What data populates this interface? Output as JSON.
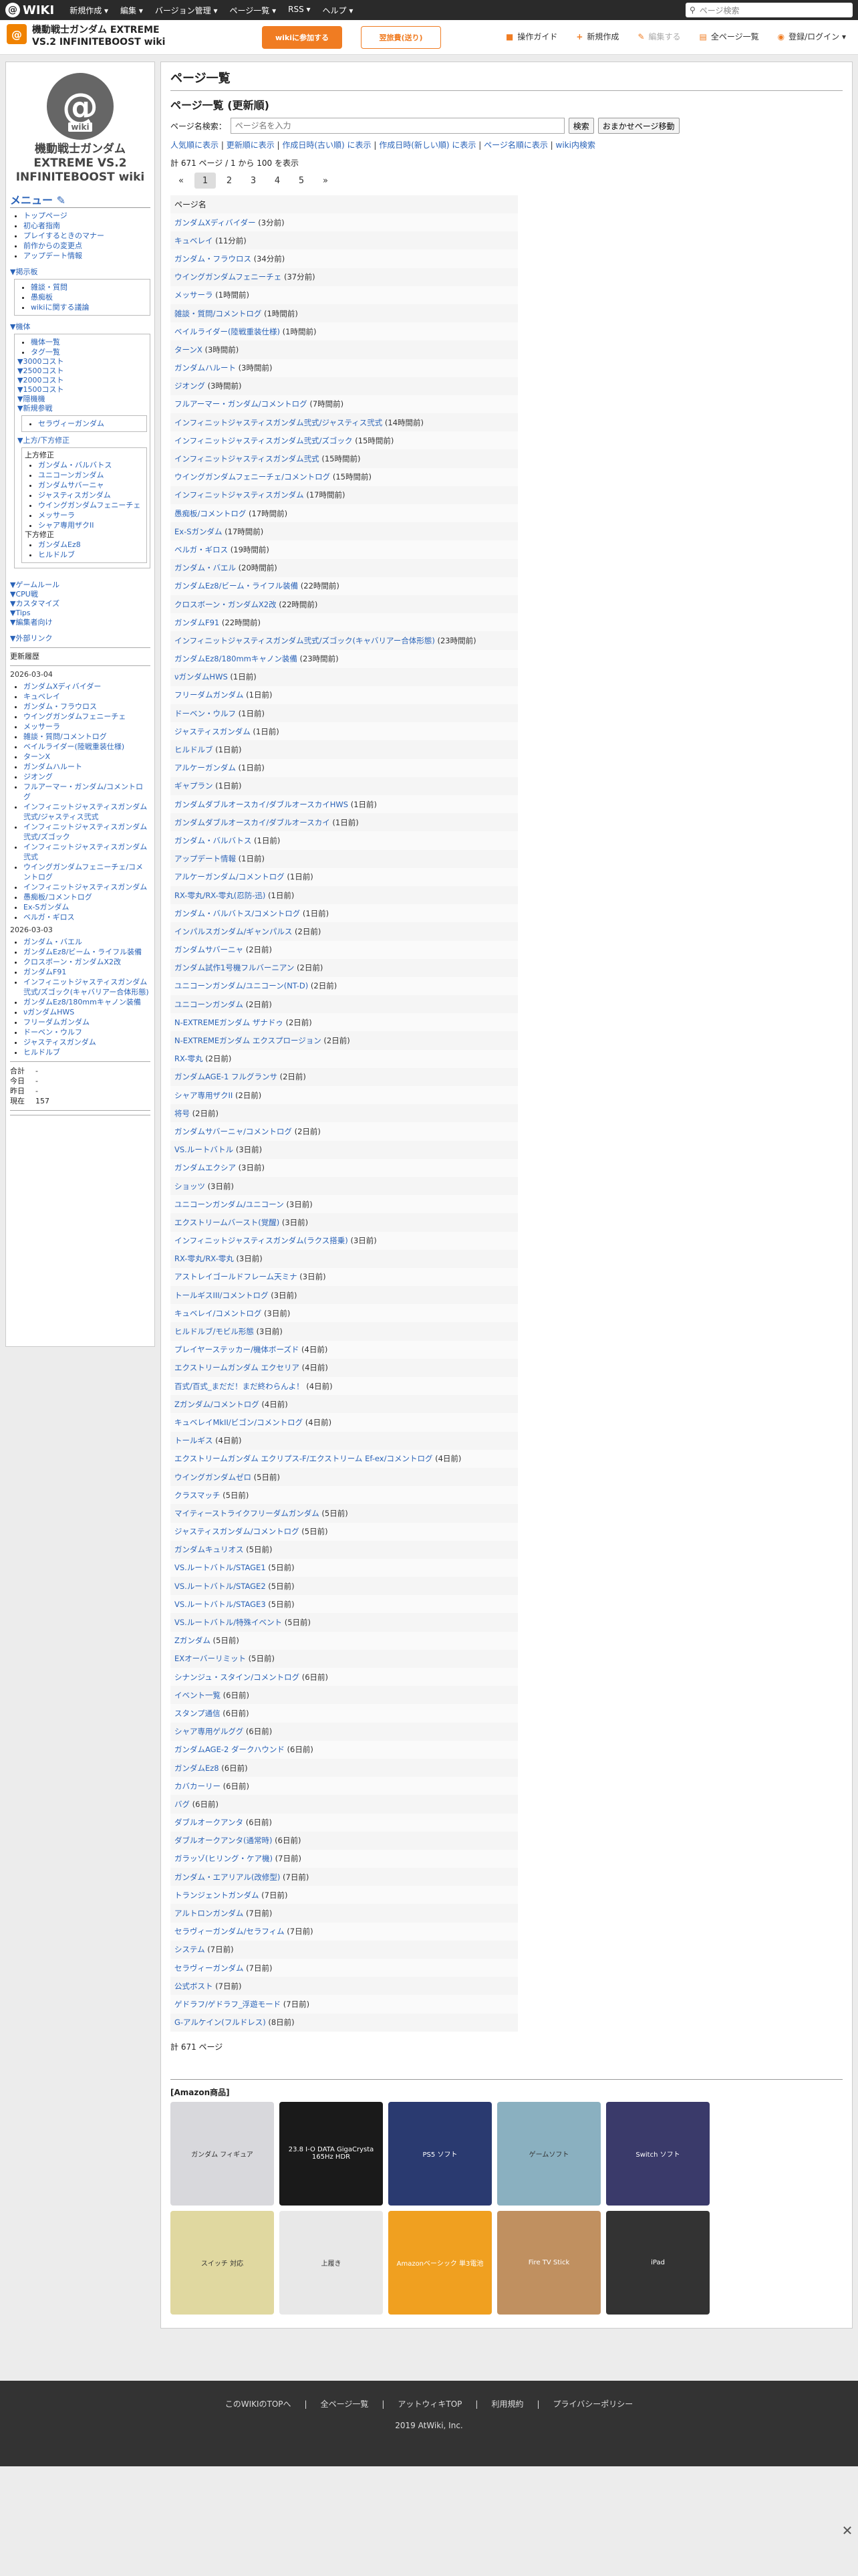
{
  "topbar": {
    "logo": "WIKI",
    "menus": [
      "新規作成 ▾",
      "編集 ▾",
      "バージョン管理 ▾",
      "ページ一覧 ▾",
      "RSS ▾",
      "ヘルプ ▾"
    ],
    "search_placeholder": "ページ検索"
  },
  "header": {
    "icon": "@",
    "title": "機動戦士ガンダム EXTREME VS.2 INFINITEBOOST wiki",
    "wiki_join": "wikiに参加する",
    "plan": "翌旅費(送り)",
    "tools": [
      {
        "icon": "■",
        "label": "操作ガイド",
        "enabled": true
      },
      {
        "icon": "+",
        "label": "新規作成",
        "enabled": true
      },
      {
        "icon": "✎",
        "label": "編集する",
        "enabled": false
      },
      {
        "icon": "▤",
        "label": "全ページ一覧",
        "enabled": true
      },
      {
        "icon": "◉",
        "label": "登録/ログイン ▾",
        "enabled": true
      }
    ]
  },
  "sidebar": {
    "avatar": "@",
    "avatar_sub": "wiki",
    "title": "機動戦士ガンダム EXTREME VS.2 INFINITEBOOST wiki",
    "menu_head": "メニュー ✎",
    "menu_items": [
      "トップページ",
      "初心者指南",
      "プレイするときのマナー",
      "前作からの変更点",
      "アップデート情報"
    ],
    "board_head": "▼掲示板",
    "board_items": [
      "雑談・質問",
      "愚痴板",
      "wikiに関する議論"
    ],
    "body_head": "▼機体",
    "body_items": [
      "機体一覧",
      "タグ一覧"
    ],
    "cost_items": [
      "▼3000コスト",
      "▼2500コスト",
      "▼2000コスト",
      "▼1500コスト",
      "▼隠機機",
      "▼新規参戦"
    ],
    "new_item": "セラヴィーガンダム",
    "upper_lower": "▼上方/下方修正",
    "upper_label": "上方修正",
    "upper_items": [
      "ガンダム・バルバトス",
      "ユニコーンガンダム",
      "ガンダムサバーニャ",
      "ジャスティスガンダム",
      "ウイングガンダムフェニーチェ",
      "メッサーラ",
      "シャア専用ザクII"
    ],
    "lower_label": "下方修正",
    "lower_items": [
      "ガンダムEz8",
      "ヒルドルブ"
    ],
    "other_secs": [
      "▼ゲームルール",
      "▼CPU戦",
      "▼カスタマイズ",
      "▼Tips",
      "▼編集者向け",
      "▼外部リンク"
    ],
    "recent_label": "更新履歴",
    "date1": "2026-03-04",
    "recent1": [
      "ガンダムXディバイダー",
      "キュベレイ",
      "ガンダム・フラウロス",
      "ウイングガンダムフェニーチェ",
      "メッサーラ",
      "雑談・質問/コメントログ",
      "ベイルライダー(陸戦重装仕様)",
      "ターンX",
      "ガンダムハルート",
      "ジオング",
      "フルアーマー・ガンダム/コメントログ",
      "インフィニットジャスティスガンダム弐式/ジャスティス弐式",
      "インフィニットジャスティスガンダム弐式/ズゴック",
      "インフィニットジャスティスガンダム弐式",
      "ウイングガンダムフェニーチェ/コメントログ",
      "インフィニットジャスティスガンダム",
      "愚痴板/コメントログ",
      "Ex-Sガンダム",
      "ベルガ・ギロス"
    ],
    "date2": "2026-03-03",
    "recent2": [
      "ガンダム・バエル",
      "ガンダムEz8/ビーム・ライフル装備",
      "クロスボーン・ガンダムX2改",
      "ガンダムF91",
      "インフィニットジャスティスガンダム弐式/ズゴック(キャバリアー合体形態)",
      "ガンダムEz8/180mmキャノン装備",
      "νガンダムHWS",
      "フリーダムガンダム",
      "ドーベン・ウルフ",
      "ジャスティスガンダム",
      "ヒルドルブ"
    ],
    "counts": [
      {
        "label": "合計",
        "value": "-"
      },
      {
        "label": "今日",
        "value": "-"
      },
      {
        "label": "昨日",
        "value": "-"
      },
      {
        "label": "現在",
        "value": "157"
      }
    ]
  },
  "main": {
    "h1": "ページ一覧",
    "h2": "ページ一覧 (更新順)",
    "search_label": "ページ名検索：",
    "search_placeholder": "ページ名を入力",
    "search_btn": "検索",
    "random_btn": "おまかせページ移動",
    "sort_links": [
      "人気順に表示",
      "更新順に表示",
      "作成日時(古い順) に表示",
      "作成日時(新しい順) に表示",
      "ページ名順に表示",
      "wiki内検索"
    ],
    "count_line": "計 671 ページ / 1 から 100 を表示",
    "pager": [
      "«",
      "1",
      "2",
      "3",
      "4",
      "5",
      "»"
    ],
    "current_page": "1",
    "table_header": "ページ名",
    "rows": [
      [
        "ガンダムXディバイダー",
        "(3分前)"
      ],
      [
        "キュベレイ",
        "(11分前)"
      ],
      [
        "ガンダム・フラウロス",
        "(34分前)"
      ],
      [
        "ウイングガンダムフェニーチェ",
        "(37分前)"
      ],
      [
        "メッサーラ",
        "(1時間前)"
      ],
      [
        "雑談・質問/コメントログ",
        "(1時間前)"
      ],
      [
        "ベイルライダー(陸戦重装仕様)",
        "(1時間前)"
      ],
      [
        "ターンX",
        "(3時間前)"
      ],
      [
        "ガンダムハルート",
        "(3時間前)"
      ],
      [
        "ジオング",
        "(3時間前)"
      ],
      [
        "フルアーマー・ガンダム/コメントログ",
        "(7時間前)"
      ],
      [
        "インフィニットジャスティスガンダム弐式/ジャスティス弐式",
        "(14時間前)"
      ],
      [
        "インフィニットジャスティスガンダム弐式/ズゴック",
        "(15時間前)"
      ],
      [
        "インフィニットジャスティスガンダム弐式",
        "(15時間前)"
      ],
      [
        "ウイングガンダムフェニーチェ/コメントログ",
        "(15時間前)"
      ],
      [
        "インフィニットジャスティスガンダム",
        "(17時間前)"
      ],
      [
        "愚痴板/コメントログ",
        "(17時間前)"
      ],
      [
        "Ex-Sガンダム",
        "(17時間前)"
      ],
      [
        "ベルガ・ギロス",
        "(19時間前)"
      ],
      [
        "ガンダム・バエル",
        "(20時間前)"
      ],
      [
        "ガンダムEz8/ビーム・ライフル装備",
        "(22時間前)"
      ],
      [
        "クロスボーン・ガンダムX2改",
        "(22時間前)"
      ],
      [
        "ガンダムF91",
        "(22時間前)"
      ],
      [
        "インフィニットジャスティスガンダム弐式/ズゴック(キャバリアー合体形態)",
        "(23時間前)"
      ],
      [
        "ガンダムEz8/180mmキャノン装備",
        "(23時間前)"
      ],
      [
        "νガンダムHWS",
        "(1日前)"
      ],
      [
        "フリーダムガンダム",
        "(1日前)"
      ],
      [
        "ドーベン・ウルフ",
        "(1日前)"
      ],
      [
        "ジャスティスガンダム",
        "(1日前)"
      ],
      [
        "ヒルドルブ",
        "(1日前)"
      ],
      [
        "アルケーガンダム",
        "(1日前)"
      ],
      [
        "ギャプラン",
        "(1日前)"
      ],
      [
        "ガンダムダブルオースカイ/ダブルオースカイHWS",
        "(1日前)"
      ],
      [
        "ガンダムダブルオースカイ/ダブルオースカイ",
        "(1日前)"
      ],
      [
        "ガンダム・バルバトス",
        "(1日前)"
      ],
      [
        "アップデート情報",
        "(1日前)"
      ],
      [
        "アルケーガンダム/コメントログ",
        "(1日前)"
      ],
      [
        "RX-零丸/RX-零丸(忍防-迅)",
        "(1日前)"
      ],
      [
        "ガンダム・バルバトス/コメントログ",
        "(1日前)"
      ],
      [
        "インパルスガンダム/ギャンパルス",
        "(2日前)"
      ],
      [
        "ガンダムサバーニャ",
        "(2日前)"
      ],
      [
        "ガンダム試作1号機フルバーニアン",
        "(2日前)"
      ],
      [
        "ユニコーンガンダム/ユニコーン(NT-D)",
        "(2日前)"
      ],
      [
        "ユニコーンガンダム",
        "(2日前)"
      ],
      [
        "N-EXTREMEガンダム ザナドゥ",
        "(2日前)"
      ],
      [
        "N-EXTREMEガンダム エクスプロージョン",
        "(2日前)"
      ],
      [
        "RX-零丸",
        "(2日前)"
      ],
      [
        "ガンダムAGE-1 フルグランサ",
        "(2日前)"
      ],
      [
        "シャア専用ザクII",
        "(2日前)"
      ],
      [
        "将号",
        "(2日前)"
      ],
      [
        "ガンダムサバーニャ/コメントログ",
        "(2日前)"
      ],
      [
        "VS.ルートバトル",
        "(3日前)"
      ],
      [
        "ガンダムエクシア",
        "(3日前)"
      ],
      [
        "ショッツ",
        "(3日前)"
      ],
      [
        "ユニコーンガンダム/ユニコーン",
        "(3日前)"
      ],
      [
        "エクストリームバースト(覚醒)",
        "(3日前)"
      ],
      [
        "インフィニットジャスティスガンダム(ラクス搭乗)",
        "(3日前)"
      ],
      [
        "RX-零丸/RX-零丸",
        "(3日前)"
      ],
      [
        "アストレイゴールドフレーム天ミナ",
        "(3日前)"
      ],
      [
        "トールギスIII/コメントログ",
        "(3日前)"
      ],
      [
        "キュベレイ/コメントログ",
        "(3日前)"
      ],
      [
        "ヒルドルブ/モビル形態",
        "(3日前)"
      ],
      [
        "プレイヤーステッカー/機体ボーズド",
        "(4日前)"
      ],
      [
        "エクストリームガンダム エクセリア",
        "(4日前)"
      ],
      [
        "百式/百式_まだだ！まだ終わらんよ！",
        "(4日前)"
      ],
      [
        "Zガンダム/コメントログ",
        "(4日前)"
      ],
      [
        "キュベレイMkII/ビゴン/コメントログ",
        "(4日前)"
      ],
      [
        "トールギス",
        "(4日前)"
      ],
      [
        "エクストリームガンダム エクリプス-F/エクストリーム Ef-ex/コメントログ",
        "(4日前)"
      ],
      [
        "ウイングガンダムゼロ",
        "(5日前)"
      ],
      [
        "クラスマッチ",
        "(5日前)"
      ],
      [
        "マイティーストライクフリーダムガンダム",
        "(5日前)"
      ],
      [
        "ジャスティスガンダム/コメントログ",
        "(5日前)"
      ],
      [
        "ガンダムキュリオス",
        "(5日前)"
      ],
      [
        "VS.ルートバトル/STAGE1",
        "(5日前)"
      ],
      [
        "VS.ルートバトル/STAGE2",
        "(5日前)"
      ],
      [
        "VS.ルートバトル/STAGE3",
        "(5日前)"
      ],
      [
        "VS.ルートバトル/特殊イベント",
        "(5日前)"
      ],
      [
        "Zガンダム",
        "(5日前)"
      ],
      [
        "EXオーバーリミット",
        "(5日前)"
      ],
      [
        "シナンジュ・スタイン/コメントログ",
        "(6日前)"
      ],
      [
        "イベント一覧",
        "(6日前)"
      ],
      [
        "スタンプ通信",
        "(6日前)"
      ],
      [
        "シャア専用ゲルググ",
        "(6日前)"
      ],
      [
        "ガンダムAGE-2 ダークハウンド",
        "(6日前)"
      ],
      [
        "ガンダムEz8",
        "(6日前)"
      ],
      [
        "カバカーリー",
        "(6日前)"
      ],
      [
        "バグ",
        "(6日前)"
      ],
      [
        "ダブルオークアンタ",
        "(6日前)"
      ],
      [
        "ダブルオークアンタ(通常時)",
        "(6日前)"
      ],
      [
        "ガラッゾ(ヒリング・ケア機)",
        "(7日前)"
      ],
      [
        "ガンダム・エアリアル(改修型)",
        "(7日前)"
      ],
      [
        "トランジェントガンダム",
        "(7日前)"
      ],
      [
        "アルトロンガンダム",
        "(7日前)"
      ],
      [
        "セラヴィーガンダム/セラフィム",
        "(7日前)"
      ],
      [
        "システム",
        "(7日前)"
      ],
      [
        "セラヴィーガンダム",
        "(7日前)"
      ],
      [
        "公式ボスト",
        "(7日前)"
      ],
      [
        "ゲドラフ/ゲドラフ_浮遊モード",
        "(7日前)"
      ],
      [
        "G-アルケイン(フルドレス)",
        "(8日前)"
      ]
    ],
    "footer_count": "計 671 ページ",
    "amazon_head": "[Amazon商品]",
    "products": [
      {
        "label": "ガンダム フィギュア",
        "color": "#d8d8dc"
      },
      {
        "label": "23.8 I-O DATA GigaCrysta 165Hz HDR",
        "color": "#1a1a1a"
      },
      {
        "label": "PS5 ソフト",
        "color": "#2a3a70"
      },
      {
        "label": "ゲームソフト",
        "color": "#8ab0c0"
      },
      {
        "label": "Switch ソフト",
        "color": "#3a3a6a"
      },
      {
        "label": "スイッチ 対応",
        "color": "#e0d8a0"
      },
      {
        "label": "上履き",
        "color": "#e8e8e8"
      },
      {
        "label": "Amazonベーシック 単3電池",
        "color": "#f0a020"
      },
      {
        "label": "Fire TV Stick",
        "color": "#c09060"
      },
      {
        "label": "iPad",
        "color": "#333"
      }
    ]
  },
  "footer": {
    "links": [
      "このWIKIのTOPへ",
      "全ページ一覧",
      "アットウィキTOP",
      "利用規約",
      "プライバシーポリシー"
    ],
    "copy": "2019 AtWiki, Inc."
  },
  "close_icon": "✕"
}
